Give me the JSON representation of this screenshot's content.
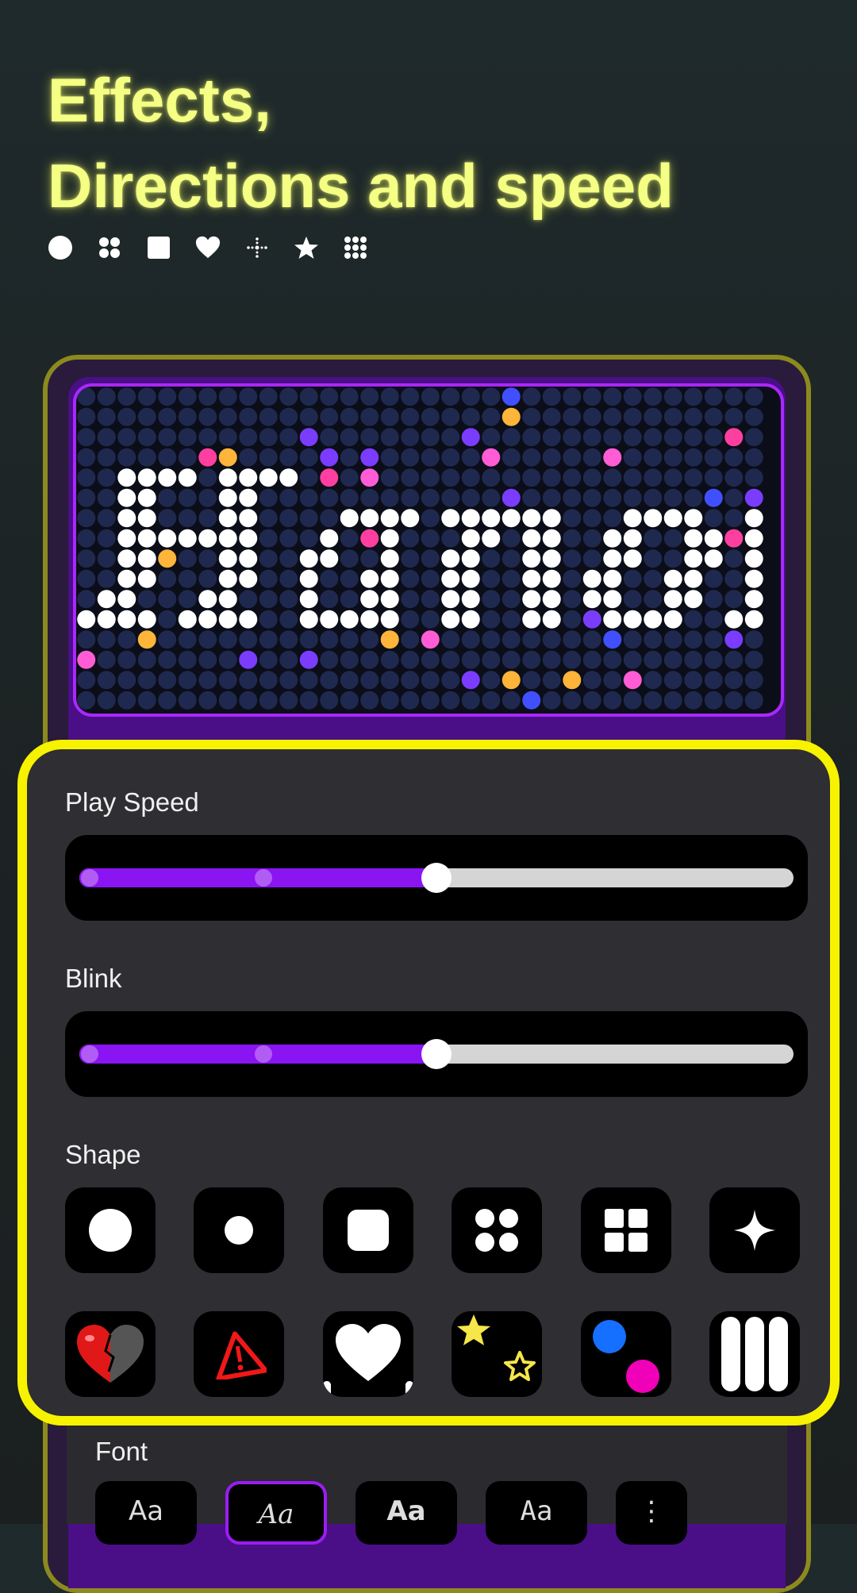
{
  "header": {
    "title_line1": "Effects,",
    "title_line2": "Directions and speed",
    "title_color": "#f4ff83",
    "icons": [
      "circle-icon",
      "four-dots-icon",
      "square-icon",
      "heart-icon",
      "crosshair-icon",
      "star-icon",
      "grid-dots-icon"
    ]
  },
  "preview": {
    "text": "Hanol k",
    "led_off_color": "#1f2950",
    "led_on_color": "#ffffff",
    "frame_color": "#a928ff"
  },
  "panel": {
    "border_color": "#f7f200",
    "play_speed": {
      "label": "Play Speed",
      "value": 50,
      "accent": "#8a14f2"
    },
    "blink": {
      "label": "Blink",
      "value": 50,
      "accent": "#8a14f2"
    },
    "shape": {
      "label": "Shape",
      "row1": [
        "circle-large-icon",
        "circle-small-icon",
        "rounded-square-icon",
        "four-dots-icon",
        "four-squares-icon",
        "sparkle-icon"
      ],
      "row2": [
        "split-heart-icon",
        "warning-triangle-icon",
        "heart-pattern-icon",
        "stars-icon",
        "blue-pink-dots-icon",
        "vertical-bars-icon"
      ]
    }
  },
  "font": {
    "label": "Font",
    "options": [
      "Aa",
      "Aa",
      "Aa",
      "Aa"
    ],
    "more_label": "⋮"
  }
}
